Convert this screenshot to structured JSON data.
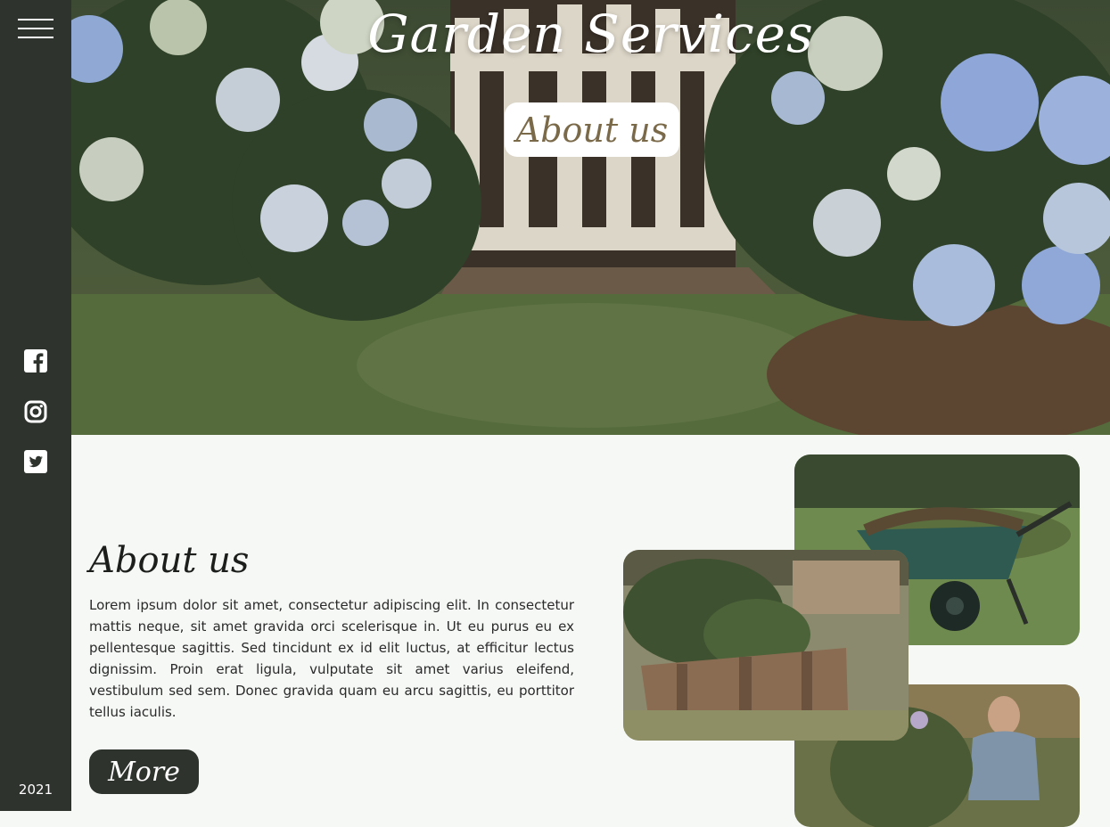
{
  "sidebar": {
    "menu_icon": "hamburger-icon",
    "social": [
      {
        "name": "facebook",
        "icon": "facebook-icon"
      },
      {
        "name": "instagram",
        "icon": "instagram-icon"
      },
      {
        "name": "twitter",
        "icon": "twitter-icon"
      }
    ],
    "year": "2021"
  },
  "hero": {
    "title": "Garden Services",
    "button_label": "About us"
  },
  "about": {
    "title": "About us",
    "body": "Lorem ipsum dolor sit amet, consectetur adipiscing elit. In consectetur mattis neque, sit amet gravida orci scelerisque in. Ut eu purus eu ex pellentesque sagittis. Sed tincidunt ex id elit luctus, at efficitur lectus dignissim. Proin erat ligula, vulputate sit amet varius eleifend, vestibulum sed sem. Donec gravida quam eu arcu sagittis, eu porttitor tellus iaculis.",
    "more_label": "More"
  },
  "colors": {
    "sidebar": "#2f332e",
    "background": "#f5f8f5",
    "button_dark": "#2f332e",
    "text": "#2a2a2a"
  }
}
